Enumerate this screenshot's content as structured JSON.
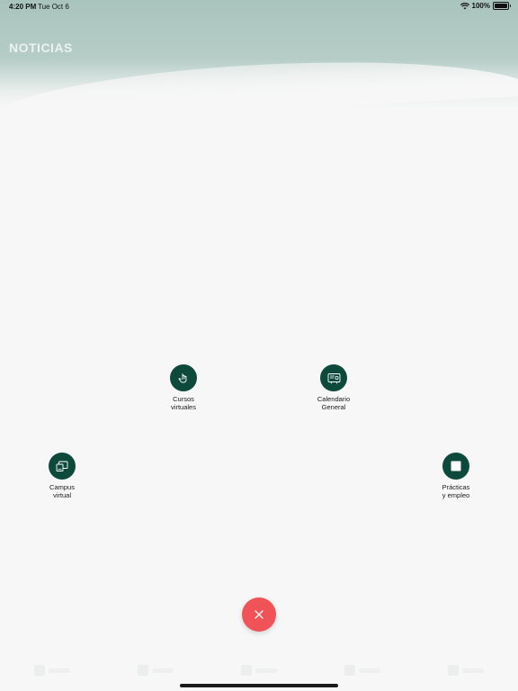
{
  "status_bar": {
    "time": "4:20 PM",
    "date": "Tue Oct 6",
    "battery": "100%"
  },
  "header": {
    "title": "NOTICIAS"
  },
  "menu": {
    "items": [
      {
        "label_line1": "Cursos",
        "label_line2": "virtuales",
        "icon": "hand-touch-icon"
      },
      {
        "label_line1": "Calendario",
        "label_line2": "General",
        "icon": "calendar-board-icon"
      },
      {
        "label_line1": "Campus",
        "label_line2": "virtual",
        "icon": "campus-screen-icon"
      },
      {
        "label_line1": "Prácticas",
        "label_line2": "y empleo",
        "icon": "square-icon"
      }
    ]
  },
  "colors": {
    "accent": "#0e4a3c",
    "close": "#ef5358",
    "header": "#a9c4bd"
  }
}
